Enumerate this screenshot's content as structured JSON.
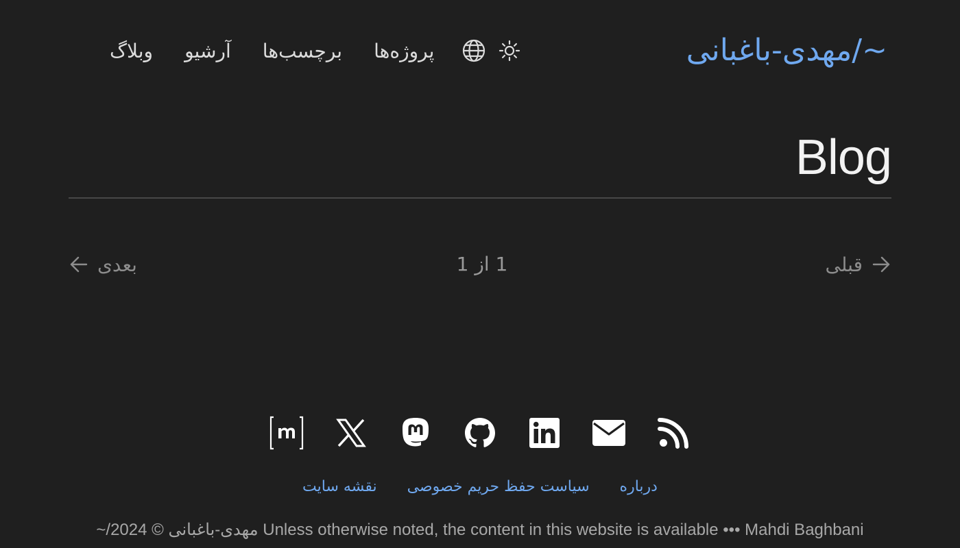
{
  "header": {
    "site_title": "~/مهدی-باغبانی",
    "nav": [
      {
        "label": "وبلاگ"
      },
      {
        "label": "آرشیو"
      },
      {
        "label": "برچسب‌ها"
      },
      {
        "label": "پروژه‌ها"
      }
    ],
    "icons": {
      "language": "globe-icon",
      "theme": "sun-icon"
    }
  },
  "main": {
    "title": "Blog"
  },
  "pagination": {
    "prev_label": "قبلی",
    "next_label": "بعدی",
    "status": "1 از 1"
  },
  "footer": {
    "social_icons": [
      "rss-icon",
      "email-icon",
      "linkedin-icon",
      "github-icon",
      "mastodon-icon",
      "x-icon",
      "matrix-icon"
    ],
    "links": [
      {
        "label": "درباره"
      },
      {
        "label": "سیاست حفظ حریم خصوصی"
      },
      {
        "label": "نقشه سایت"
      }
    ],
    "copyright": "~/مهدی-باغبانی © 2024 Unless otherwise noted, the content in this website is available ••• Mahdi Baghbani"
  },
  "colors": {
    "background": "#1f1f1f",
    "accent": "#6fa8ef",
    "text": "#e6e6e6",
    "muted": "#8c8c8c"
  }
}
